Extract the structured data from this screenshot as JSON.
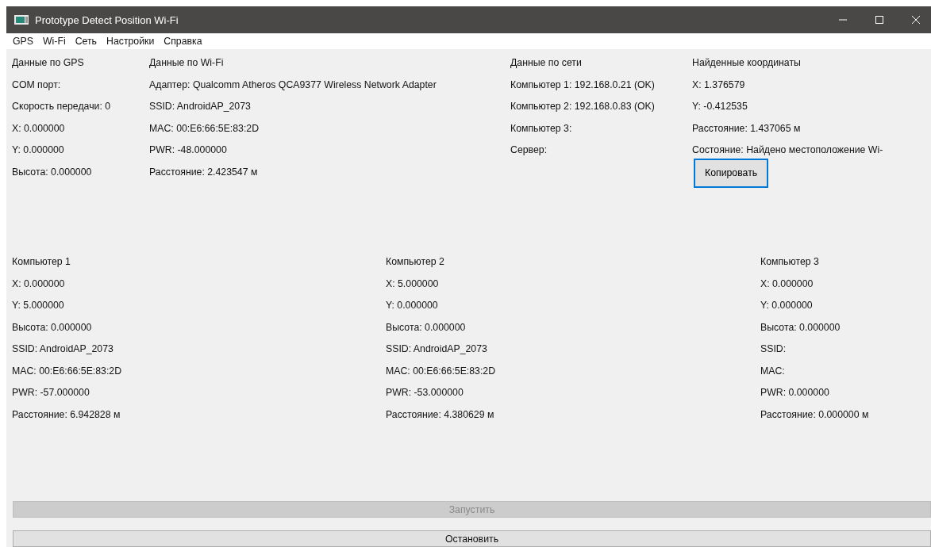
{
  "window": {
    "title": "Prototype Detect Position Wi-Fi"
  },
  "menu": [
    "GPS",
    "Wi-Fi",
    "Сеть",
    "Настройки",
    "Справка"
  ],
  "top_columns": [
    {
      "heading": "Данные по GPS",
      "lines": [
        "COM порт:",
        "Скорость передачи: 0",
        "X: 0.000000",
        "Y: 0.000000",
        "Высота: 0.000000"
      ]
    },
    {
      "heading": "Данные по Wi-Fi",
      "lines": [
        "Адаптер: Qualcomm Atheros QCA9377 Wireless Network Adapter",
        "SSID: AndroidAP_2073",
        "MAC: 00:E6:66:5E:83:2D",
        "PWR: -48.000000",
        "Расстояние: 2.423547 м"
      ]
    },
    {
      "heading": "Данные по сети",
      "lines": [
        "Компьютер 1: 192.168.0.21 (OK)",
        "Компьютер 2: 192.168.0.83 (OK)",
        "Компьютер 3:",
        "Сервер:"
      ]
    },
    {
      "heading": "Найденные координаты",
      "lines": [
        "X: 1.376579",
        "Y: -0.412535",
        "Расстояние: 1.437065 м",
        "Состояние: Найдено местоположение Wi-"
      ],
      "button": "Копировать"
    }
  ],
  "computers": [
    {
      "heading": "Компьютер 1",
      "lines": [
        "X: 0.000000",
        "Y: 5.000000",
        "Высота: 0.000000",
        "SSID: AndroidAP_2073",
        "MAC: 00:E6:66:5E:83:2D",
        "PWR: -57.000000",
        "Расстояние: 6.942828 м"
      ]
    },
    {
      "heading": "Компьютер 2",
      "lines": [
        "X: 5.000000",
        "Y: 0.000000",
        "Высота: 0.000000",
        "SSID: AndroidAP_2073",
        "MAC: 00:E6:66:5E:83:2D",
        "PWR: -53.000000",
        "Расстояние: 4.380629 м"
      ]
    },
    {
      "heading": "Компьютер 3",
      "lines": [
        "X: 0.000000",
        "Y: 0.000000",
        "Высота: 0.000000",
        "SSID:",
        "MAC:",
        "PWR: 0.000000",
        "Расстояние: 0.000000 м"
      ]
    }
  ],
  "buttons": [
    {
      "label": "Запустить",
      "disabled": true
    },
    {
      "label": "Остановить",
      "disabled": false
    }
  ]
}
